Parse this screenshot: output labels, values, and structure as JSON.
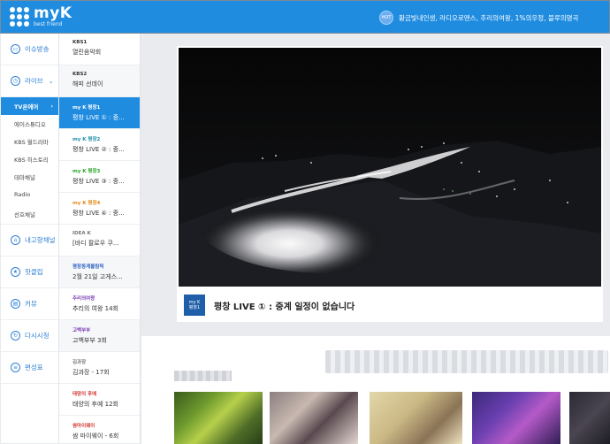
{
  "header": {
    "logo_text": "myK",
    "logo_sub": "best friend",
    "hot_label": "HOT",
    "ticker": "황금빛내인생, 라디오로맨스, 추리의여왕, 1%의우정, 블루의명곡"
  },
  "left_menu": {
    "items": [
      {
        "label": "이슈방송",
        "icon": "tv-icon"
      },
      {
        "label": "라이브",
        "icon": "clock-icon"
      }
    ],
    "sub_items": [
      "TV온에어",
      "에이스튜디오",
      "KBS 월드라마",
      "KBS 히스토리",
      "테마채널",
      "Radio",
      "선호채널"
    ],
    "items_bottom": [
      {
        "label": "내고향채널",
        "icon": "home-icon"
      },
      {
        "label": "핫클립",
        "icon": "star-icon"
      },
      {
        "label": "커뮤",
        "icon": "chat-icon"
      },
      {
        "label": "다시시청",
        "icon": "replay-icon"
      },
      {
        "label": "편성표",
        "icon": "list-icon"
      }
    ]
  },
  "channels": [
    {
      "name": "KBS1",
      "program": "열린음악회"
    },
    {
      "name": "KBS2",
      "program": "해피 선데이"
    },
    {
      "name": "my K 평창1",
      "program": "평창 LIVE ① : 중..."
    },
    {
      "name": "my K 평창2",
      "program": "평창 LIVE ② : 중..."
    },
    {
      "name": "my K 평창3",
      "program": "평창 LIVE ③ : 중..."
    },
    {
      "name": "my K 평창4",
      "program": "평창 LIVE ④ : 중..."
    },
    {
      "name": "IDEA K",
      "program": "[바디 팔로우 쿠..."
    },
    {
      "name": "평창동계올림픽",
      "program": "2월 21일 고게스..."
    },
    {
      "name": "추리의여왕",
      "program": "추리의 여왕 14회"
    },
    {
      "name": "고백부부",
      "program": "고백부부 3회"
    },
    {
      "name": "김과장",
      "program": "김과장 - 17회"
    },
    {
      "name": "태양의 후예",
      "program": "태양의 후예 12회"
    },
    {
      "name": "쌈마이웨이",
      "program": "쌈 마이웨이 - 6회"
    }
  ],
  "player": {
    "logo_line1": "my K",
    "logo_line2": "평창1",
    "title": "평창 LIVE ① : 중계 일정이 없습니다"
  },
  "colors": {
    "brand": "#1f8ce0",
    "background": "#e9ebee"
  }
}
